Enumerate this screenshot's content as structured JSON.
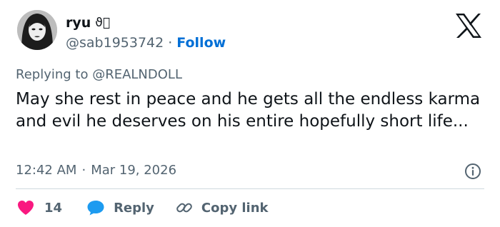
{
  "author": {
    "display_name": "ryu",
    "name_emoji": "ϑ⃞",
    "handle": "@sab1953742",
    "separator": "·",
    "follow_label": "Follow"
  },
  "reply_context": {
    "text": "Replying to @REALNDOLL"
  },
  "tweet": {
    "text": "May she rest in peace and he gets all the endless karma and evil he deserves on his entire hopefully short life..."
  },
  "meta": {
    "time": "12:42 AM",
    "separator": "·",
    "date": "Mar 19, 2026"
  },
  "actions": {
    "like_count": "14",
    "reply_label": "Reply",
    "copy_label": "Copy link"
  },
  "icons": {
    "logo": "x-logo-icon",
    "info": "info-icon",
    "like": "heart-icon",
    "reply": "reply-bubble-icon",
    "copy": "link-icon"
  },
  "colors": {
    "text": "#0f1419",
    "secondary": "#536471",
    "link": "#006fd6",
    "like": "#f91880",
    "reply": "#1d9bf0",
    "divider": "#cfd9de"
  }
}
